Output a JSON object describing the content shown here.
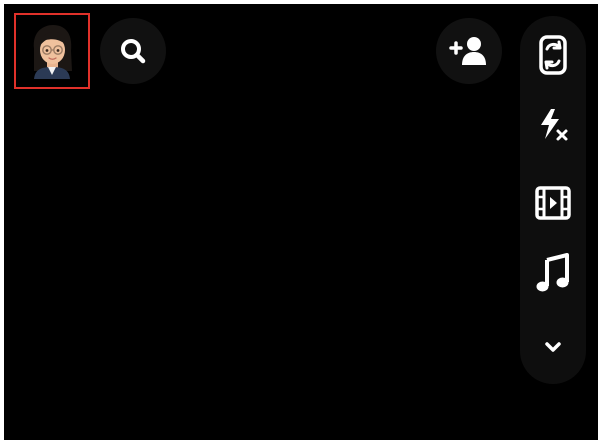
{
  "camera": {
    "profile": {
      "icon": "bitmoji-avatar-icon",
      "highlighted": true,
      "highlight_color": "#e0312a"
    },
    "header": {
      "search_icon": "search-icon",
      "add_friend_icon": "add-friend-icon"
    },
    "tools": [
      {
        "name": "flip-camera",
        "icon": "flip-camera-icon"
      },
      {
        "name": "flash-off",
        "icon": "flash-off-icon"
      },
      {
        "name": "video-mode",
        "icon": "video-icon"
      },
      {
        "name": "music",
        "icon": "music-note-icon"
      },
      {
        "name": "more-tools",
        "icon": "chevron-down-icon"
      }
    ],
    "colors": {
      "background": "#000000",
      "icon": "#ffffff",
      "button_bg": "#111111"
    }
  }
}
